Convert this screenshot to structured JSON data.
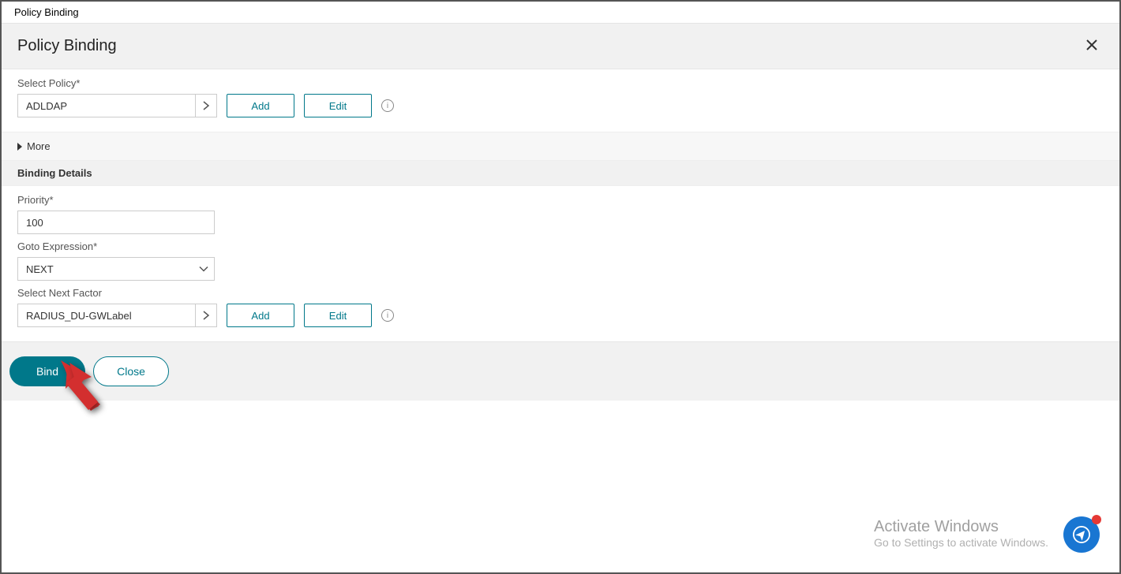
{
  "breadcrumb": "Policy Binding",
  "header": {
    "title": "Policy Binding"
  },
  "selectPolicy": {
    "label": "Select Policy*",
    "value": "ADLDAP",
    "addLabel": "Add",
    "editLabel": "Edit"
  },
  "more": {
    "label": "More"
  },
  "bindingDetails": {
    "heading": "Binding Details"
  },
  "priority": {
    "label": "Priority*",
    "value": "100"
  },
  "gotoExpr": {
    "label": "Goto Expression*",
    "value": "NEXT"
  },
  "nextFactor": {
    "label": "Select Next Factor",
    "value": "RADIUS_DU-GWLabel",
    "addLabel": "Add",
    "editLabel": "Edit"
  },
  "footer": {
    "bind": "Bind",
    "close": "Close"
  },
  "watermark": {
    "title": "Activate Windows",
    "sub": "Go to Settings to activate Windows."
  }
}
